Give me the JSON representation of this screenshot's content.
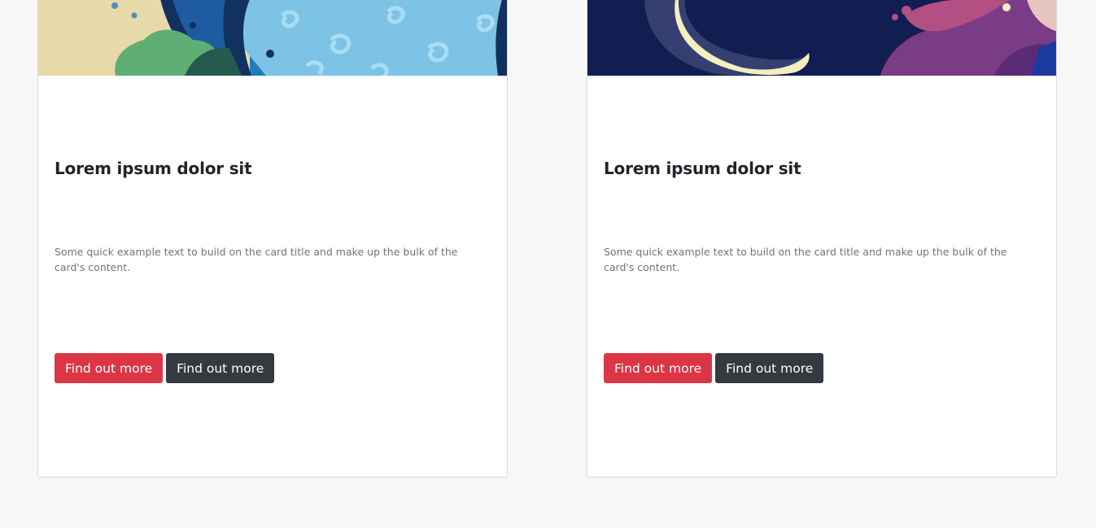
{
  "cards": [
    {
      "title": "Lorem ipsum dolor sit",
      "text": "Some quick example text to build on the card title and make up the bulk of the card's content.",
      "primary_button": "Find out more",
      "secondary_button": "Find out more"
    },
    {
      "title": "Lorem ipsum dolor sit",
      "text": "Some quick example text to build on the card title and make up the bulk of the card's content.",
      "primary_button": "Find out more",
      "secondary_button": "Find out more"
    }
  ],
  "colors": {
    "page_background": "#f7f7f7",
    "card_background": "#ffffff",
    "primary_button": "#dc3545",
    "secondary_button": "#343a40",
    "title_text": "#212529",
    "body_text": "#6c757d"
  }
}
